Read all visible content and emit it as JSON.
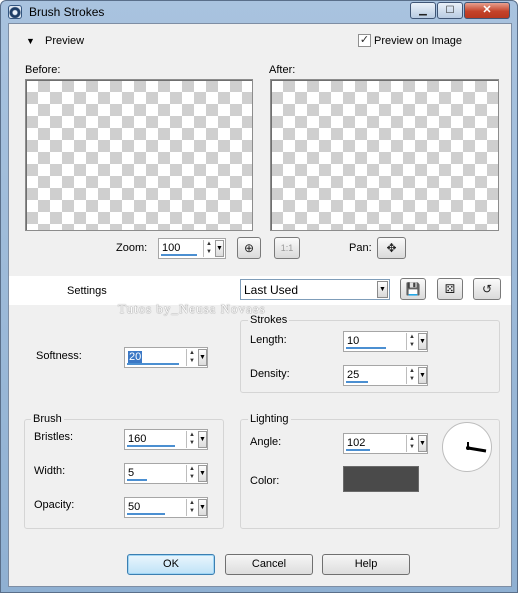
{
  "window": {
    "title": "Brush Strokes",
    "controls": {
      "minimize": "▁",
      "maximize": "☐",
      "close": "✕"
    }
  },
  "preview": {
    "toggle_label": "Preview",
    "preview_on_image_label": "Preview on Image",
    "preview_on_image_checked": true,
    "before_label": "Before:",
    "after_label": "After:",
    "zoom_label": "Zoom:",
    "zoom_value": "100",
    "actual_size_label": "1:1",
    "pan_label": "Pan:"
  },
  "settings": {
    "label": "Settings",
    "preset_value": "Last Used"
  },
  "watermark": "Tutos by_Neusa Novaes",
  "softness": {
    "label": "Softness:",
    "value": "20"
  },
  "strokes": {
    "title": "Strokes",
    "length_label": "Length:",
    "length_value": "10",
    "density_label": "Density:",
    "density_value": "25"
  },
  "brush": {
    "title": "Brush",
    "bristles_label": "Bristles:",
    "bristles_value": "160",
    "width_label": "Width:",
    "width_value": "5",
    "opacity_label": "Opacity:",
    "opacity_value": "50"
  },
  "lighting": {
    "title": "Lighting",
    "angle_label": "Angle:",
    "angle_value": "102",
    "color_label": "Color:",
    "color_hex": "#4a4a4a"
  },
  "buttons": {
    "ok": "OK",
    "cancel": "Cancel",
    "help": "Help"
  },
  "colors": {
    "accent": "#4b8fd1",
    "selection": "#3b78c5",
    "titlebar": "#a9c3df"
  }
}
